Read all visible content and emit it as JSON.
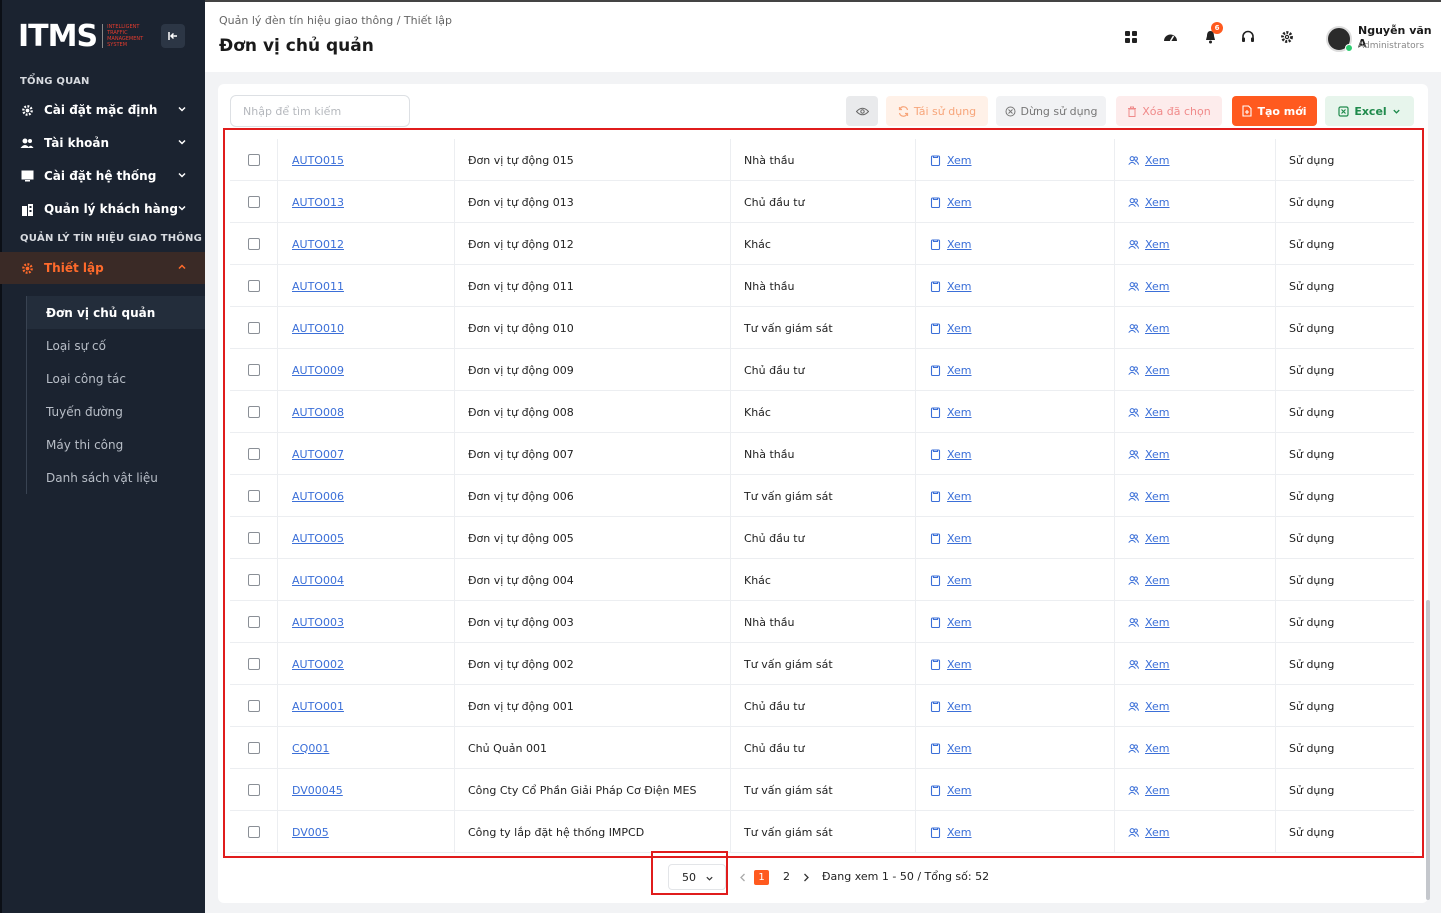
{
  "app": {
    "logo_main": "ITMS",
    "logo_sub": "INTELLIGENT TRAFFIC MANAGEMENT SYSTEM"
  },
  "sidebar": {
    "section1": "TỔNG QUAN",
    "items": [
      {
        "label": "Cài đặt mặc định",
        "icon": "gear-icon"
      },
      {
        "label": "Tài khoản",
        "icon": "users-icon"
      },
      {
        "label": "Cài đặt hệ thống",
        "icon": "monitor-icon"
      },
      {
        "label": "Quản lý khách hàng",
        "icon": "building-icon"
      }
    ],
    "section2": "QUẢN LÝ TÍN HIỆU GIAO THÔNG",
    "active_item": {
      "label": "Thiết lập",
      "icon": "gear-icon"
    },
    "subitems": [
      "Đơn vị chủ quản",
      "Loại sự cố",
      "Loại công tác",
      "Tuyến đường",
      "Máy thi công",
      "Danh sách vật liệu"
    ]
  },
  "header": {
    "breadcrumb": "Quản lý đèn tín hiệu giao thông  /  Thiết lập",
    "title": "Đơn vị chủ quản",
    "notification_count": "6",
    "user_name": "Nguyễn văn A",
    "user_role": "Administrators"
  },
  "toolbar": {
    "search_placeholder": "Nhập để tìm kiếm",
    "reuse_label": "Tái sử dụng",
    "stop_label": "Dừng sử dụng",
    "delete_label": "Xóa đã chọn",
    "create_label": "Tạo mới",
    "excel_label": "Excel"
  },
  "table": {
    "view_label": "Xem",
    "rows": [
      {
        "code": "AUTO015",
        "name": "Đơn vị tự động 015",
        "type": "Nhà thầu",
        "status": "Sử dụng"
      },
      {
        "code": "AUTO013",
        "name": "Đơn vị tự động 013",
        "type": "Chủ đầu tư",
        "status": "Sử dụng"
      },
      {
        "code": "AUTO012",
        "name": "Đơn vị tự động 012",
        "type": "Khác",
        "status": "Sử dụng"
      },
      {
        "code": "AUTO011",
        "name": "Đơn vị tự động 011",
        "type": "Nhà thầu",
        "status": "Sử dụng"
      },
      {
        "code": "AUTO010",
        "name": "Đơn vị tự động 010",
        "type": "Tư vấn giám sát",
        "status": "Sử dụng"
      },
      {
        "code": "AUTO009",
        "name": "Đơn vị tự động 009",
        "type": "Chủ đầu tư",
        "status": "Sử dụng"
      },
      {
        "code": "AUTO008",
        "name": "Đơn vị tự động 008",
        "type": "Khác",
        "status": "Sử dụng"
      },
      {
        "code": "AUTO007",
        "name": "Đơn vị tự động 007",
        "type": "Nhà thầu",
        "status": "Sử dụng"
      },
      {
        "code": "AUTO006",
        "name": "Đơn vị tự động 006",
        "type": "Tư vấn giám sát",
        "status": "Sử dụng"
      },
      {
        "code": "AUTO005",
        "name": "Đơn vị tự động 005",
        "type": "Chủ đầu tư",
        "status": "Sử dụng"
      },
      {
        "code": "AUTO004",
        "name": "Đơn vị tự động 004",
        "type": "Khác",
        "status": "Sử dụng"
      },
      {
        "code": "AUTO003",
        "name": "Đơn vị tự động 003",
        "type": "Nhà thầu",
        "status": "Sử dụng"
      },
      {
        "code": "AUTO002",
        "name": "Đơn vị tự động 002",
        "type": "Tư vấn giám sát",
        "status": "Sử dụng"
      },
      {
        "code": "AUTO001",
        "name": "Đơn vị tự động 001",
        "type": "Chủ đầu tư",
        "status": "Sử dụng"
      },
      {
        "code": "CQ001",
        "name": "Chủ Quản 001",
        "type": "Chủ đầu tư",
        "status": "Sử dụng"
      },
      {
        "code": "DV00045",
        "name": "Công Cty Cổ Phần Giải Pháp Cơ Điện MES",
        "type": "Tư vấn giám sát",
        "status": "Sử dụng"
      },
      {
        "code": "DV005",
        "name": "Công ty lắp đặt hệ thống IMPCD",
        "type": "Tư vấn giám sát",
        "status": "Sử dụng"
      }
    ]
  },
  "pagination": {
    "page_size": "50",
    "current_page": "1",
    "next_page": "2",
    "info": "Đang xem 1 - 50 / Tổng số: 52"
  },
  "colors": {
    "accent": "#ff5a1f",
    "sidebar_bg": "#1b2330",
    "link": "#3b6fd8",
    "highlight": "#e01c1c"
  }
}
